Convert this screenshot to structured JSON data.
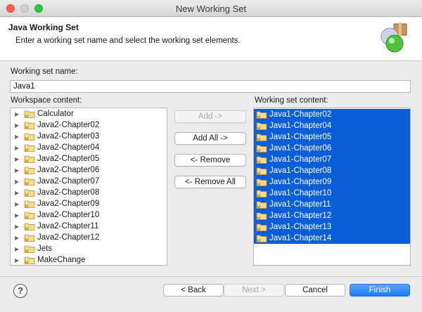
{
  "window": {
    "title": "New Working Set"
  },
  "header": {
    "title": "Java Working Set",
    "description": "Enter a working set name and select the working set elements."
  },
  "form": {
    "name_label": "Working set name:",
    "name_value": "Java1",
    "workspace_label": "Workspace content:",
    "working_set_label": "Working set content:"
  },
  "workspace_items": [
    {
      "label": "Calculator"
    },
    {
      "label": "Java2-Chapter02"
    },
    {
      "label": "Java2-Chapter03"
    },
    {
      "label": "Java2-Chapter04"
    },
    {
      "label": "Java2-Chapter05"
    },
    {
      "label": "Java2-Chapter06"
    },
    {
      "label": "Java2-Chapter07"
    },
    {
      "label": "Java2-Chapter08"
    },
    {
      "label": "Java2-Chapter09"
    },
    {
      "label": "Java2-Chapter10"
    },
    {
      "label": "Java2-Chapter11"
    },
    {
      "label": "Java2-Chapter12"
    },
    {
      "label": "Jets"
    },
    {
      "label": "MakeChange"
    }
  ],
  "buttons": {
    "add": "Add ->",
    "add_all": "Add All ->",
    "remove": "<- Remove",
    "remove_all": "<- Remove All"
  },
  "working_set_items": [
    {
      "label": "Java1-Chapter02"
    },
    {
      "label": "Java1-Chapter04"
    },
    {
      "label": "Java1-Chapter05"
    },
    {
      "label": "Java1-Chapter06"
    },
    {
      "label": "Java1-Chapter07"
    },
    {
      "label": "Java1-Chapter08"
    },
    {
      "label": "Java1-Chapter09"
    },
    {
      "label": "Java1-Chapter10"
    },
    {
      "label": "Java1-Chapter11"
    },
    {
      "label": "Java1-Chapter12"
    },
    {
      "label": "Java1-Chapter13"
    },
    {
      "label": "Java1-Chapter14"
    }
  ],
  "footer": {
    "help_glyph": "?",
    "back": "< Back",
    "next": "Next >",
    "cancel": "Cancel",
    "finish": "Finish"
  },
  "colors": {
    "selection": "#0a5ed7",
    "primary_button": "#1b7cf4"
  }
}
